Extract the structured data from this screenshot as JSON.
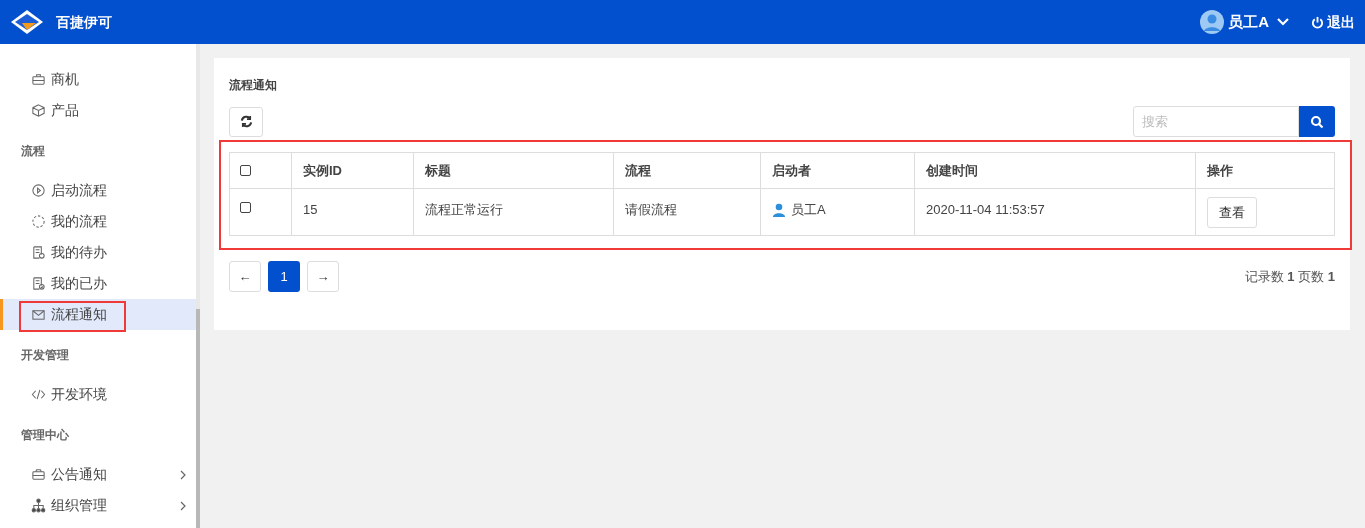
{
  "header": {
    "app_name": "百捷伊可",
    "user": "员工A",
    "logout": "退出"
  },
  "sidebar": {
    "sections": [
      {
        "items": [
          {
            "label": "商机",
            "selected": false,
            "highlighted": false,
            "has_submenu": false
          },
          {
            "label": "产品",
            "selected": false,
            "highlighted": false,
            "has_submenu": false
          }
        ]
      },
      {
        "title": "流程",
        "items": [
          {
            "label": "启动流程",
            "selected": false,
            "highlighted": false,
            "has_submenu": false
          },
          {
            "label": "我的流程",
            "selected": false,
            "highlighted": false,
            "has_submenu": false
          },
          {
            "label": "我的待办",
            "selected": false,
            "highlighted": false,
            "has_submenu": false
          },
          {
            "label": "我的已办",
            "selected": false,
            "highlighted": false,
            "has_submenu": false
          },
          {
            "label": "流程通知",
            "selected": true,
            "highlighted": true,
            "has_submenu": false
          }
        ]
      },
      {
        "title": "开发管理",
        "items": [
          {
            "label": "开发环境",
            "selected": false,
            "highlighted": false,
            "has_submenu": false
          }
        ]
      },
      {
        "title": "管理中心",
        "items": [
          {
            "label": "公告通知",
            "selected": false,
            "highlighted": false,
            "has_submenu": true
          },
          {
            "label": "组织管理",
            "selected": false,
            "highlighted": false,
            "has_submenu": true
          }
        ]
      }
    ]
  },
  "panel": {
    "title": "流程通知",
    "search": {
      "placeholder": "搜索"
    },
    "table": {
      "highlighted": true,
      "select_all_checked": false,
      "columns": [
        "实例ID",
        "标题",
        "流程",
        "启动者",
        "创建时间",
        "操作"
      ],
      "rows": [
        {
          "checked": false,
          "id": "15",
          "title": "流程正常运行",
          "process": "请假流程",
          "starter": "员工A",
          "created": "2020-11-04 11:53:57",
          "action": "查看"
        }
      ]
    },
    "pagination": {
      "prev": "←",
      "pages": [
        {
          "label": "1",
          "selected": true
        }
      ],
      "next": "→"
    },
    "summary": "记录数 **1** 页数 **1**"
  }
}
